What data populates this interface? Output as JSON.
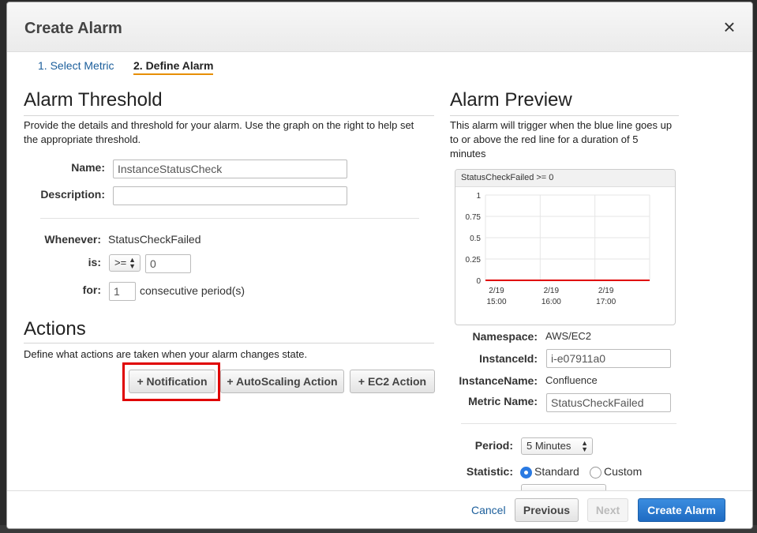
{
  "dialog": {
    "title": "Create Alarm",
    "close_glyph": "×"
  },
  "steps": [
    {
      "label": "1. Select Metric"
    },
    {
      "label": "2. Define Alarm"
    }
  ],
  "threshold": {
    "title": "Alarm Threshold",
    "description_line1": "Provide the details and threshold for your alarm. Use the graph on the right to help set",
    "description_line2": "the appropriate threshold.",
    "name_label": "Name:",
    "name_value": "InstanceStatusCheck",
    "description_label": "Description:",
    "description_value": "",
    "whenever_label": "Whenever:",
    "whenever_value": "StatusCheckFailed",
    "is_label": "is:",
    "operator": ">=",
    "threshold_value": "0",
    "for_label": "for:",
    "periods_value": "1",
    "periods_suffix": "consecutive period(s)"
  },
  "actions": {
    "title": "Actions",
    "description": "Define what actions are taken when your alarm changes state.",
    "buttons": [
      {
        "label": "+ Notification"
      },
      {
        "label": "+ AutoScaling Action"
      },
      {
        "label": "+ EC2 Action"
      }
    ]
  },
  "preview": {
    "title": "Alarm Preview",
    "description_line1": "This alarm will trigger when the blue line goes up",
    "description_line2": "to or above the red line for a duration of 5",
    "description_line3": "minutes",
    "chart_header": "StatusCheckFailed >= 0",
    "namespace_label": "Namespace:",
    "namespace_value": "AWS/EC2",
    "instanceid_label": "InstanceId:",
    "instanceid_value": "i-e07911a0",
    "instancename_label": "InstanceName:",
    "instancename_value": "Confluence",
    "metricname_label": "Metric Name:",
    "metricname_value": "StatusCheckFailed",
    "period_label": "Period:",
    "period_value": "5 Minutes",
    "statistic_label": "Statistic:",
    "statistic_options": [
      {
        "label": "Standard",
        "selected": true
      },
      {
        "label": "Custom",
        "selected": false
      }
    ]
  },
  "footer": {
    "cancel_label": "Cancel",
    "previous_label": "Previous",
    "next_label": "Next",
    "create_label": "Create Alarm"
  },
  "colors": {
    "accent": "#1f6bc2",
    "highlight": "#e00000",
    "threshold_line": "#e00000",
    "step_underline": "#e78e00"
  },
  "chart_data": {
    "type": "line",
    "title": "StatusCheckFailed >= 0",
    "y_ticks": [
      "1",
      "0.75",
      "0.5",
      "0.25",
      "0"
    ],
    "ylim": [
      0,
      1
    ],
    "x_tick_dates": [
      "2/19",
      "2/19",
      "2/19"
    ],
    "x_tick_times": [
      "15:00",
      "16:00",
      "17:00"
    ],
    "threshold": 0,
    "series": [
      {
        "values": [
          0,
          0
        ]
      }
    ],
    "grid": true
  }
}
